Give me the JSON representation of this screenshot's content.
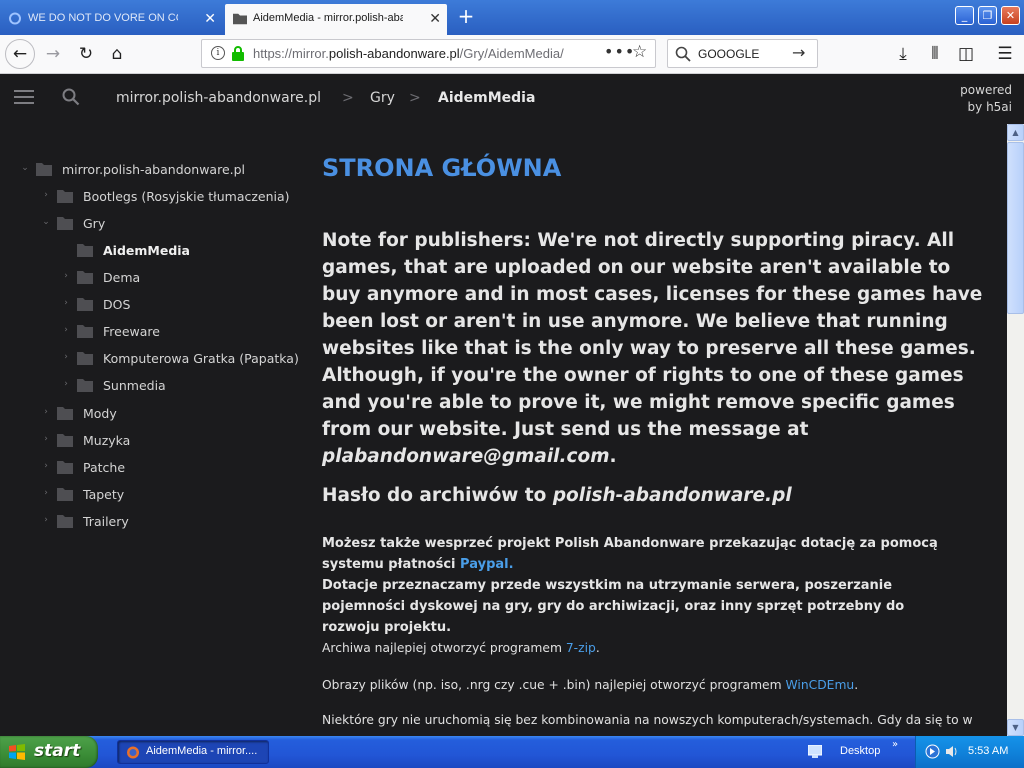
{
  "browser": {
    "tabs": [
      {
        "title": "WE DO NOT DO VORE ON COLLAB",
        "active": false
      },
      {
        "title": "AidemMedia - mirror.polish-abandonware",
        "active": true
      }
    ],
    "url": {
      "prefix": "https://mirror.",
      "domain": "polish-abandonware.pl",
      "path": "/Gry/AidemMedia/"
    },
    "search_engine": "GOOOGLE",
    "toolbar_icons": [
      "back-icon",
      "forward-icon",
      "reload-icon",
      "home-icon",
      "info-icon",
      "lock-icon",
      "page-actions-icon",
      "bookmark-star-icon",
      "download-icon",
      "library-icon",
      "sidebar-icon",
      "menu-icon"
    ]
  },
  "header": {
    "breadcrumb": [
      {
        "label": "mirror.polish-abandonware.pl"
      },
      {
        "label": "Gry"
      },
      {
        "label": "AidemMedia",
        "current": true
      }
    ],
    "separator": ">",
    "powered_line1": "powered",
    "powered_line2": "by h5ai"
  },
  "sidebar": {
    "items": [
      {
        "label": "mirror.polish-abandonware.pl",
        "level": 0,
        "expanded": true
      },
      {
        "label": "Bootlegs (Rosyjskie tłumaczenia)",
        "level": 1,
        "expanded": false
      },
      {
        "label": "Gry",
        "level": 1,
        "expanded": true
      },
      {
        "label": "AidemMedia",
        "level": 2,
        "active": true
      },
      {
        "label": "Dema",
        "level": 2
      },
      {
        "label": "DOS",
        "level": 2
      },
      {
        "label": "Freeware",
        "level": 2
      },
      {
        "label": "Komputerowa Gratka (Papatka)",
        "level": 2
      },
      {
        "label": "Sunmedia",
        "level": 2
      },
      {
        "label": "Mody",
        "level": 1
      },
      {
        "label": "Muzyka",
        "level": 1
      },
      {
        "label": "Patche",
        "level": 1
      },
      {
        "label": "Tapety",
        "level": 1
      },
      {
        "label": "Trailery",
        "level": 1
      }
    ]
  },
  "main": {
    "title": "STRONA GŁÓWNA",
    "notice_text": "Note for publishers: We're not directly supporting piracy. All games, that are uploaded on our website aren't available to buy anymore and in most cases, licenses for these games have been lost or aren't in use anymore. We believe that running websites like that is the only way to preserve all these games. Although, if you're the owner of rights to one of these games and you're able to prove it, we might remove specific games from our website. Just send us the message at",
    "notice_email": "plabandonware@gmail.com",
    "notice_end": ".",
    "password_label": "Hasło do archiwów to",
    "password_value": "polish-abandonware.pl",
    "donate_text": "Możesz także wesprzeć projekt Polish Abandonware przekazując dotację za pomocą systemu płatności",
    "donate_link": "Paypal.",
    "donate_text2": "Dotacje przeznaczamy przede wszystkim na utrzymanie serwera, poszerzanie pojemności dyskowej na gry, gry do archiwizacji, oraz inny sprzęt potrzebny do rozwoju projektu.",
    "zip_text": "Archiwa najlepiej otworzyć programem",
    "zip_link": "7-zip",
    "zip_end": ".",
    "images_text": "Obrazy plików (np. iso, .nrg czy .cue + .bin) najlepiej otworzyć programem",
    "images_link": "WinCDEmu",
    "images_end": ".",
    "compat_text": "Niektóre gry nie uruchomią się bez kombinowania na nowszych komputerach/systemach. Gdy da się to w"
  },
  "taskbar": {
    "start_label": "start",
    "task_label": "AidemMedia - mirror....",
    "desktop_label": "Desktop",
    "clock": "5:53 AM"
  },
  "colors": {
    "accent": "#4a90e2",
    "link": "#4a9ee8",
    "background": "#1b1b1d",
    "xp_taskbar": "#245edc",
    "xp_start": "#3a8c36"
  }
}
